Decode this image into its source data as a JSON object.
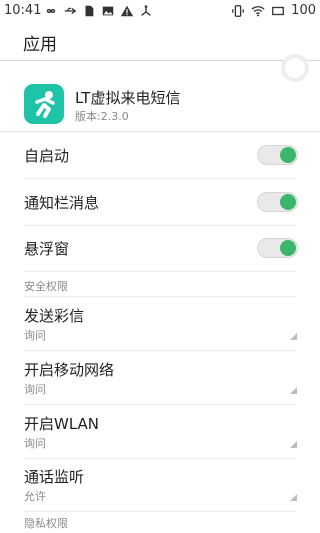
{
  "status_bar": {
    "time": "10:41",
    "battery": "100",
    "left_icons": [
      "infinity-icon",
      "usb-icon",
      "sim-card-icon",
      "image-icon",
      "warning-icon",
      "network-share-icon"
    ],
    "right_icons": [
      "vibrate-icon",
      "wifi-icon",
      "screen-icon"
    ]
  },
  "header": {
    "title": "应用"
  },
  "app": {
    "name": "LT虚拟来电短信",
    "version": "版本:2.3.0",
    "icon_color": "#1fc3a8"
  },
  "toggles": [
    {
      "label": "自启动",
      "on": true
    },
    {
      "label": "通知栏消息",
      "on": true
    },
    {
      "label": "悬浮窗",
      "on": true
    }
  ],
  "sections": {
    "security": "安全权限",
    "privacy": "隐私权限"
  },
  "permissions": [
    {
      "label": "发送彩信",
      "value": "询问"
    },
    {
      "label": "开启移动网络",
      "value": "询问"
    },
    {
      "label": "开启WLAN",
      "value": "询问"
    },
    {
      "label": "通话监听",
      "value": "允许"
    }
  ],
  "colors": {
    "toggle_on": "#3cb66c",
    "divider": "#ececec"
  }
}
